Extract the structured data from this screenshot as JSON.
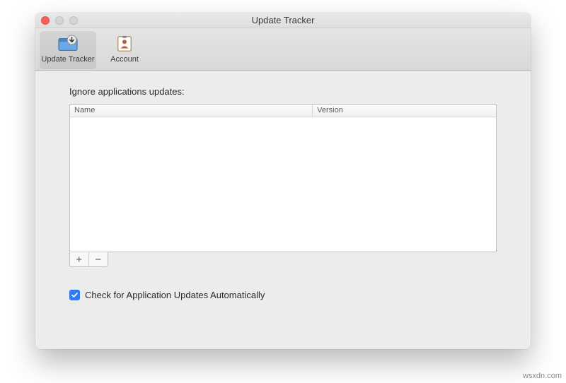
{
  "window": {
    "title": "Update Tracker"
  },
  "toolbar": {
    "items": [
      {
        "label": "Update Tracker",
        "icon": "download-box-icon",
        "selected": true
      },
      {
        "label": "Account",
        "icon": "person-card-icon",
        "selected": false
      }
    ]
  },
  "content": {
    "ignore_label": "Ignore applications updates:",
    "table": {
      "columns": {
        "name": "Name",
        "version": "Version"
      },
      "rows": []
    },
    "add_glyph": "+",
    "remove_glyph": "−",
    "auto_check": {
      "checked": true,
      "label": "Check for Application Updates Automatically"
    }
  },
  "watermark": "wsxdn.com"
}
